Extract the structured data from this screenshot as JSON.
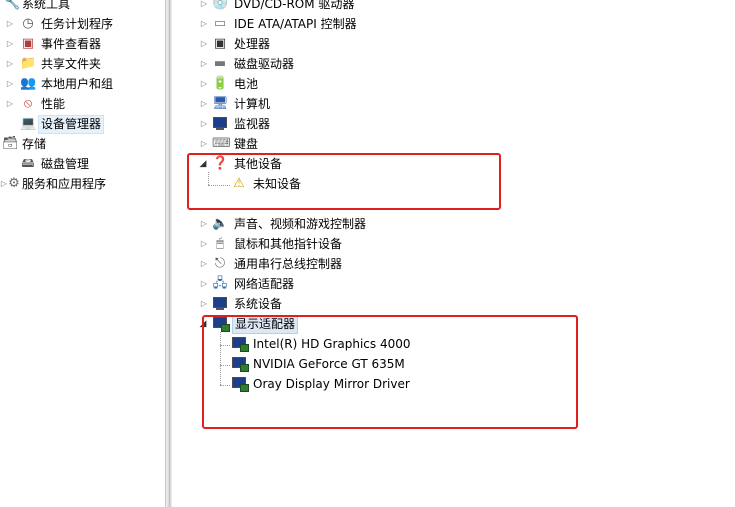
{
  "left_tree": {
    "items": [
      {
        "label": "系统工具"
      },
      {
        "label": "任务计划程序"
      },
      {
        "label": "事件查看器"
      },
      {
        "label": "共享文件夹"
      },
      {
        "label": "本地用户和组"
      },
      {
        "label": "性能"
      },
      {
        "label": "设备管理器"
      },
      {
        "label": "存储"
      },
      {
        "label": "磁盘管理"
      },
      {
        "label": "服务和应用程序"
      }
    ],
    "selected": "设备管理器"
  },
  "device_tree": {
    "items": [
      {
        "label": "DVD/CD-ROM 驱动器",
        "icon": "dvd-drive-icon"
      },
      {
        "label": "IDE ATA/ATAPI 控制器",
        "icon": "ide-controller-icon"
      },
      {
        "label": "处理器",
        "icon": "processor-icon"
      },
      {
        "label": "磁盘驱动器",
        "icon": "disk-drive-icon"
      },
      {
        "label": "电池",
        "icon": "battery-icon"
      },
      {
        "label": "计算机",
        "icon": "computer-icon"
      },
      {
        "label": "监视器",
        "icon": "monitor-icon"
      },
      {
        "label": "键盘",
        "icon": "keyboard-icon"
      },
      {
        "label": "其他设备",
        "icon": "unknown-device-icon",
        "expanded": true,
        "children": [
          {
            "label": "未知设备",
            "icon": "warning-device-icon"
          }
        ]
      },
      {
        "label": "声音、视频和游戏控制器",
        "icon": "sound-icon"
      },
      {
        "label": "鼠标和其他指针设备",
        "icon": "mouse-icon"
      },
      {
        "label": "通用串行总线控制器",
        "icon": "usb-icon"
      },
      {
        "label": "网络适配器",
        "icon": "network-adapter-icon"
      },
      {
        "label": "系统设备",
        "icon": "system-device-icon"
      },
      {
        "label": "显示适配器",
        "icon": "display-adapter-icon",
        "expanded": true,
        "children": [
          {
            "label": "Intel(R) HD Graphics 4000",
            "icon": "display-adapter-icon"
          },
          {
            "label": "NVIDIA GeForce GT 635M",
            "icon": "display-adapter-icon"
          },
          {
            "label": "Oray Display Mirror Driver",
            "icon": "display-adapter-icon"
          }
        ]
      }
    ]
  },
  "annotation_color": "#e02020"
}
